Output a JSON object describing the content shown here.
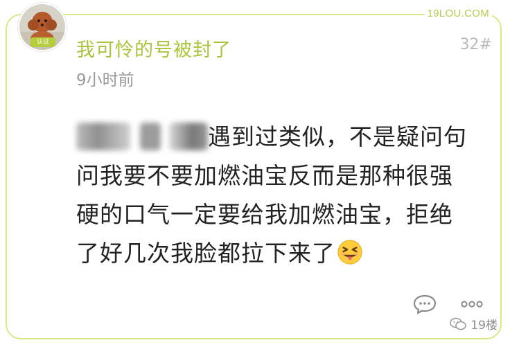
{
  "post": {
    "username": "我可怜的号被封了",
    "floor": "32#",
    "timestamp": "9小时前",
    "body": {
      "line1": "遇到过类似，不是疑问句",
      "line2": "问我要不要加燃油宝反而是那种很强",
      "line3": "硬的口气一定要给我加燃油宝，拒绝",
      "line4": "了好几次我脸都拉下来了"
    },
    "avatar_badge": "认证"
  },
  "watermarks": {
    "top": "19LOU.COM",
    "bottom": "19楼"
  },
  "icons": {
    "comment": "comment-bubble-icon",
    "more": "more-dots-icon",
    "emoji": "tongue-out-face-emoji",
    "wechat": "wechat-icon"
  },
  "colors": {
    "accent_green": "#a8c43a",
    "border_green": "#d8ea86",
    "text": "#222222",
    "muted": "#9a9a9a"
  }
}
